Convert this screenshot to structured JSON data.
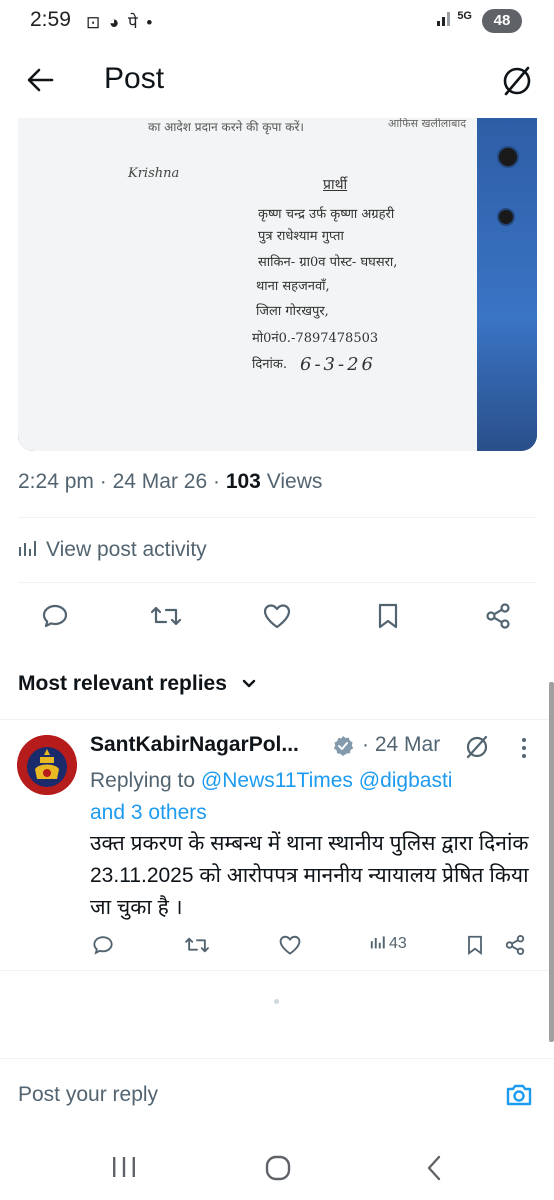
{
  "status_bar": {
    "time": "2:59",
    "icons_left": "⊡ ◕ पे •",
    "network": "5G",
    "battery": "48"
  },
  "header": {
    "title": "Post"
  },
  "photo": {
    "top_line": "का आदेश प्रदान करने की कृपा करें।",
    "top_line_right": "आफिस खलीलाबाद",
    "signature": "Krishna",
    "heading": "प्रार्थी",
    "lines": [
      "कृष्ण चन्द्र उर्फ कृष्णा अग्रहरी",
      "पुत्र राधेश्याम गुप्ता",
      "साकिन- ग्रा0व पोस्ट- घघसरा,",
      "थाना सहजनवॉं,",
      "जिला गोरखपुर,",
      "मो0नं0.-7897478503"
    ],
    "date_label": "दिनांक.",
    "date_value": "6-3-26"
  },
  "meta": {
    "time": "2:24 pm",
    "sep1": "·",
    "date": "24 Mar 26",
    "sep2": "·",
    "views_count": "103",
    "views_label": "Views"
  },
  "activity_label": "View post activity",
  "replies_heading": "Most relevant replies",
  "reply": {
    "name": "SantKabirNagarPol...",
    "date": "· 24 Mar",
    "replying_prefix": "Replying to",
    "mention1": "@News11Times",
    "mention2": "@digbasti",
    "others": "and 3 others",
    "text": "उक्त प्रकरण के सम्बन्ध में थाना स्थानीय पुलिस द्वारा दिनांक 23.11.2025 को आरोपपत्र माननीय न्यायालय प्रेषित किया जा चुका है ।",
    "views": "43"
  },
  "reply_box": {
    "placeholder": "Post your reply"
  },
  "colors": {
    "accent": "#1d9bf0",
    "muted": "#536471",
    "text": "#0f1419"
  }
}
